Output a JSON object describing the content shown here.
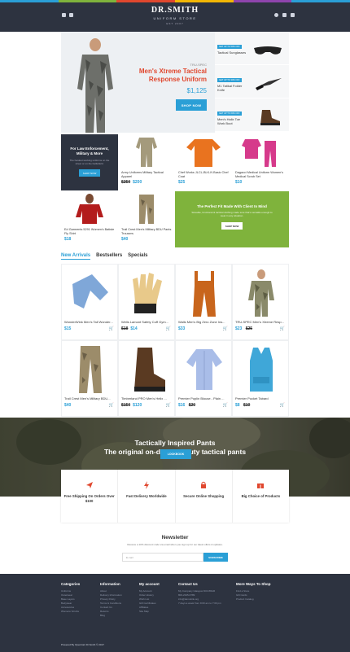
{
  "header": {
    "logo_name": "DR.SMITH",
    "logo_sub": "UNIFORM STORE",
    "logo_est": "EST 2007",
    "stripe_colors": [
      "#2a9fd6",
      "#7fb33c",
      "#e0472e",
      "#f2b705",
      "#8e44ad",
      "#2a9fd6"
    ]
  },
  "hero": {
    "brand": "TRU-SPEC",
    "title": "Men's Xtreme Tactical Response Uniform",
    "price": "$1,125",
    "button": "SHOP NOW"
  },
  "side_items": [
    {
      "badge": "GET UP TO 50% OFF",
      "name": "Tactical Sunglasses"
    },
    {
      "badge": "GET UP TO 30% OFF",
      "name": "M1 Tatikal Folder Knife"
    },
    {
      "badge": "GET UP TO 60% OFF",
      "name": "Men's Halix Toe Work Boot"
    }
  ],
  "promo_dark": {
    "title": "For Law Enforcement, Military & More",
    "text": "The hardest working uniforms on the street or on the battlefield.",
    "button": "SHOP NOW"
  },
  "grid": [
    {
      "name": "Army Uniforms Military Tactical Apparel",
      "old": "$250",
      "price": "$200"
    },
    {
      "name": "Chef Works JLCL-BLK-N Basic Chef Coat",
      "old": "",
      "price": "$25"
    },
    {
      "name": "Dagacci Medical Uniform Women's Medical Scrub Set",
      "old": "",
      "price": "$10"
    },
    {
      "name": "Ed Garments 5291 Women's Batiste Fly Shirt",
      "old": "",
      "price": "$18"
    },
    {
      "name": "Trail Crest Men's Military BDU Pants Trousers",
      "old": "",
      "price": "$40"
    }
  ],
  "promo_green": {
    "title": "The Perfect Fit Made With Client In Mind",
    "text": "Sizeable, functional & tactical clothing made sure that's versatile enough to wear in any situation.",
    "button": "SHOP NOW"
  },
  "tabs": [
    "New Arrivals",
    "Bestsellers",
    "Specials"
  ],
  "products_row1": [
    {
      "name": "WonderWink Men's Tall Wonder...",
      "old": "",
      "price": "$15"
    },
    {
      "name": "Wells Lamont Safety Cuff Gym...",
      "old": "$18",
      "price": "$14"
    },
    {
      "name": "Walls Men's Big Zero Zone Ins...",
      "old": "",
      "price": "$33"
    },
    {
      "name": "TRU-SPEC Men's Xtreme Resp...",
      "old": "$25",
      "price": "$23"
    }
  ],
  "products_row2": [
    {
      "name": "Trail Crest Men's Military BDU...",
      "old": "",
      "price": "$40"
    },
    {
      "name": "Timberland PRO Men's Helix ...",
      "old": "$150",
      "price": "$120"
    },
    {
      "name": "Premier Poplin Blouse - Plain ...",
      "old": "$20",
      "price": "$16"
    },
    {
      "name": "Premier Pocket Tabard",
      "old": "$10",
      "price": "$8"
    }
  ],
  "banner": {
    "title": "Tactically Inspired Pants",
    "subtitle": "The original on-duty, off-duty tactical pants",
    "button": "LOOKBOOK"
  },
  "features": [
    {
      "icon": "paper-plane-icon",
      "text": "Free Shipping On Orders Over $100"
    },
    {
      "icon": "lightning-icon",
      "text": "Fast Delivery Worldwide"
    },
    {
      "icon": "lock-icon",
      "text": "Secure Online Shopping"
    },
    {
      "icon": "gift-icon",
      "text": "Big Choice of Products"
    }
  ],
  "newsletter": {
    "title": "Newsletter",
    "text": "Receive a 10% discount code via email when you sign up for our latest offers & updates.",
    "placeholder": "E-mail",
    "button": "SUBSCRIBE"
  },
  "footer": {
    "columns": [
      {
        "title": "Categories",
        "items": [
          "Uniforms",
          "Outerwear",
          "Base Layers",
          "Bodywear",
          "Accessories",
          "Womens Scrubs"
        ]
      },
      {
        "title": "Information",
        "items": [
          "About",
          "Delivery Information",
          "Privacy Policy",
          "Terms & Conditions",
          "Contact Us",
          "Returns",
          "Blog"
        ]
      },
      {
        "title": "My account",
        "items": [
          "My Account",
          "Order History",
          "Wish List",
          "Gift Certificates",
          "Affiliates",
          "Site Map"
        ]
      },
      {
        "title": "Contact Us",
        "items": [
          "My Company Glasgow D04 89GR",
          "800-2345-6789",
          "info@demolink.org",
          "7 days a week from 9:00 am to 7:00 pm"
        ]
      },
      {
        "title": "More Ways To Shop",
        "items": [
          "Find a Store",
          "Gift Cards",
          "Product Catalog"
        ]
      }
    ],
    "copyright": "Powered By OpenCart Dr.Smith © 2017"
  }
}
